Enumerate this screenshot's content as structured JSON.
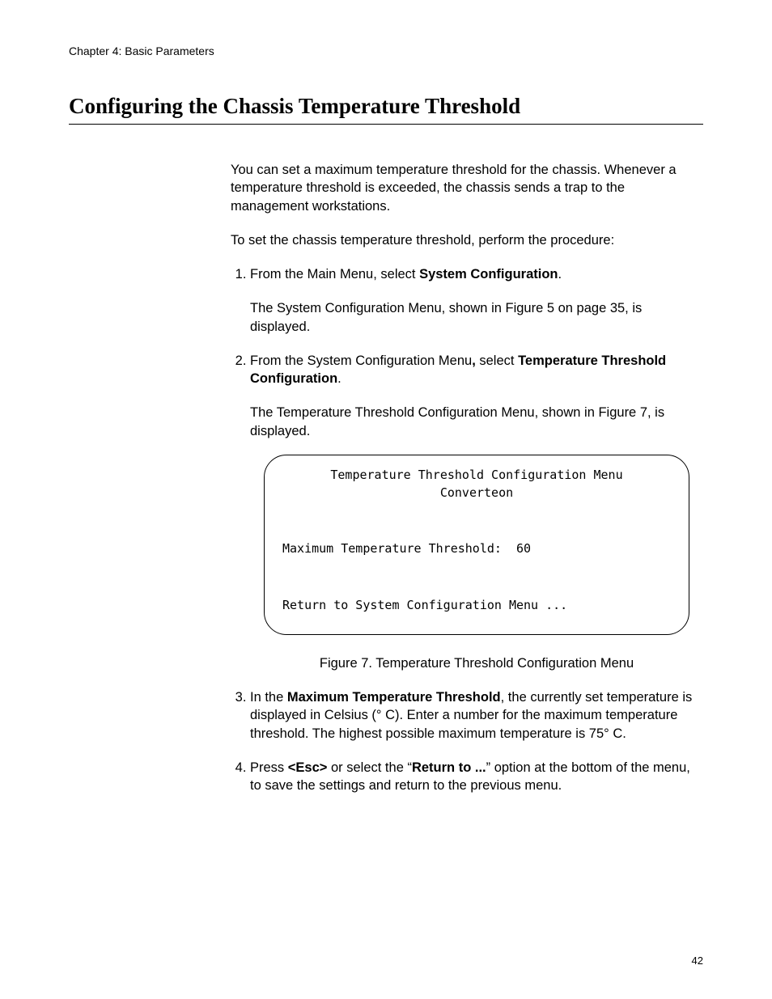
{
  "header": {
    "chapter": "Chapter 4: Basic Parameters"
  },
  "section": {
    "title": "Configuring the Chassis Temperature Threshold"
  },
  "intro": {
    "p1": "You can set a maximum temperature threshold for the chassis. Whenever a temperature threshold is exceeded, the chassis sends a trap to the management workstations.",
    "p2": "To set the chassis temperature threshold, perform the procedure:"
  },
  "steps": {
    "s1_pre": "From the Main Menu, select ",
    "s1_bold": "System Configuration",
    "s1_post": ".",
    "s1_body": "The System Configuration Menu, shown in Figure 5 on page 35, is displayed.",
    "s2_pre": "From the System Configuration Menu",
    "s2_bold_comma": ",",
    "s2_mid": " select ",
    "s2_bold": "Temperature Threshold Configuration",
    "s2_post": ".",
    "s2_body": "The Temperature Threshold Configuration Menu, shown in Figure 7, is displayed.",
    "s3_pre": "In the ",
    "s3_bold": "Maximum Temperature Threshold",
    "s3_post": ", the currently set temperature is displayed in Celsius (° C). Enter a number for the maximum temperature threshold. The highest possible maximum temperature is 75° C.",
    "s4_pre": "Press ",
    "s4_esc": "<Esc>",
    "s4_mid1": " or select the “",
    "s4_return": "Return to ...",
    "s4_mid2": "” option at the bottom of the menu, to save the settings and return to the previous menu."
  },
  "menu": {
    "title": "Temperature Threshold Configuration Menu",
    "subtitle": "Converteon",
    "line1": "Maximum Temperature Threshold:  60",
    "line2": "Return to System Configuration Menu ..."
  },
  "figure": {
    "caption": "Figure 7. Temperature Threshold Configuration Menu"
  },
  "page_number": "42"
}
